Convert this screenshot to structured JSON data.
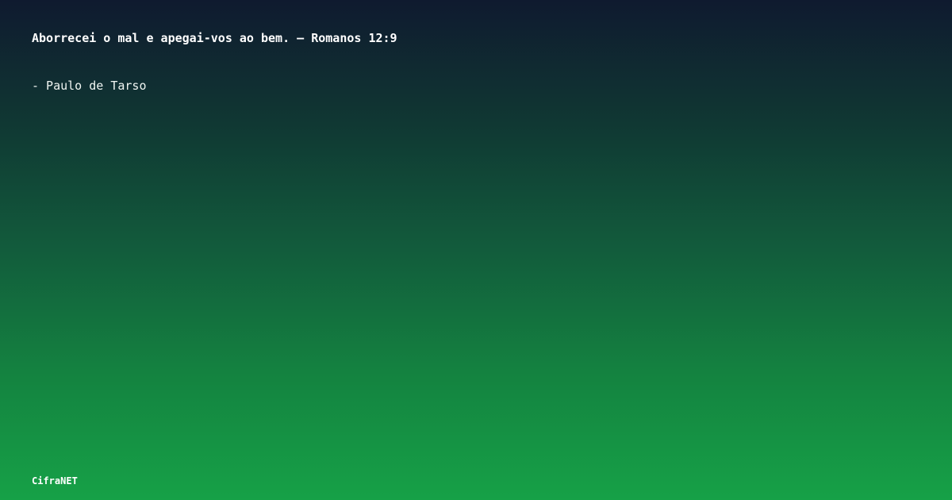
{
  "card": {
    "quote": "Aborrecei o mal e apegai-vos ao bem. — Romanos 12:9",
    "author": "- Paulo de Tarso",
    "brand": "CifraNET"
  },
  "colors": {
    "background_top": "#0f1a2f",
    "background_bottom": "#16a147",
    "text": "#ffffff"
  }
}
